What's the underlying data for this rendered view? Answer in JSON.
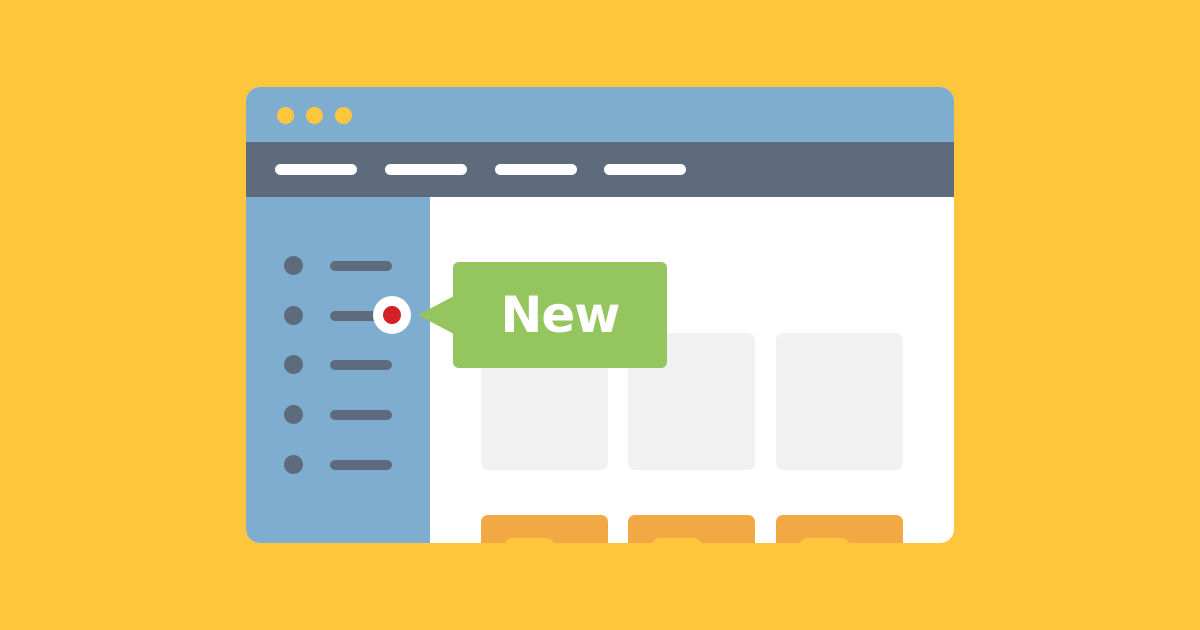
{
  "illustration": {
    "description": "Browser window illustration with a 'New' callout pointing to a sidebar item",
    "colors": {
      "background": "#FEC63C",
      "titlebar": "#7EADCF",
      "navbar": "#5E6B7D",
      "sidebar": "#7EADCF",
      "content": "#FFFFFF",
      "card": "#F1F1F2",
      "button": "#F2A944",
      "button_pill": "#FEC63C",
      "callout": "#94C55E",
      "notification_dot": "#D42128"
    }
  },
  "window": {
    "titlebar": {
      "window_controls": [
        "dot",
        "dot",
        "dot"
      ]
    },
    "navbar": {
      "items": [
        "nav-placeholder-1",
        "nav-placeholder-2",
        "nav-placeholder-3",
        "nav-placeholder-4"
      ]
    },
    "sidebar": {
      "items": [
        {
          "name": "sidebar-item-1",
          "new": false
        },
        {
          "name": "sidebar-item-2",
          "new": true
        },
        {
          "name": "sidebar-item-3",
          "new": false
        },
        {
          "name": "sidebar-item-4",
          "new": false
        },
        {
          "name": "sidebar-item-5",
          "new": false
        }
      ]
    },
    "content": {
      "cards": [
        "card-1",
        "card-2",
        "card-3"
      ],
      "buttons": [
        "button-1",
        "button-2",
        "button-3"
      ]
    }
  },
  "callout": {
    "label": "New",
    "icon": "notification-dot-icon"
  }
}
